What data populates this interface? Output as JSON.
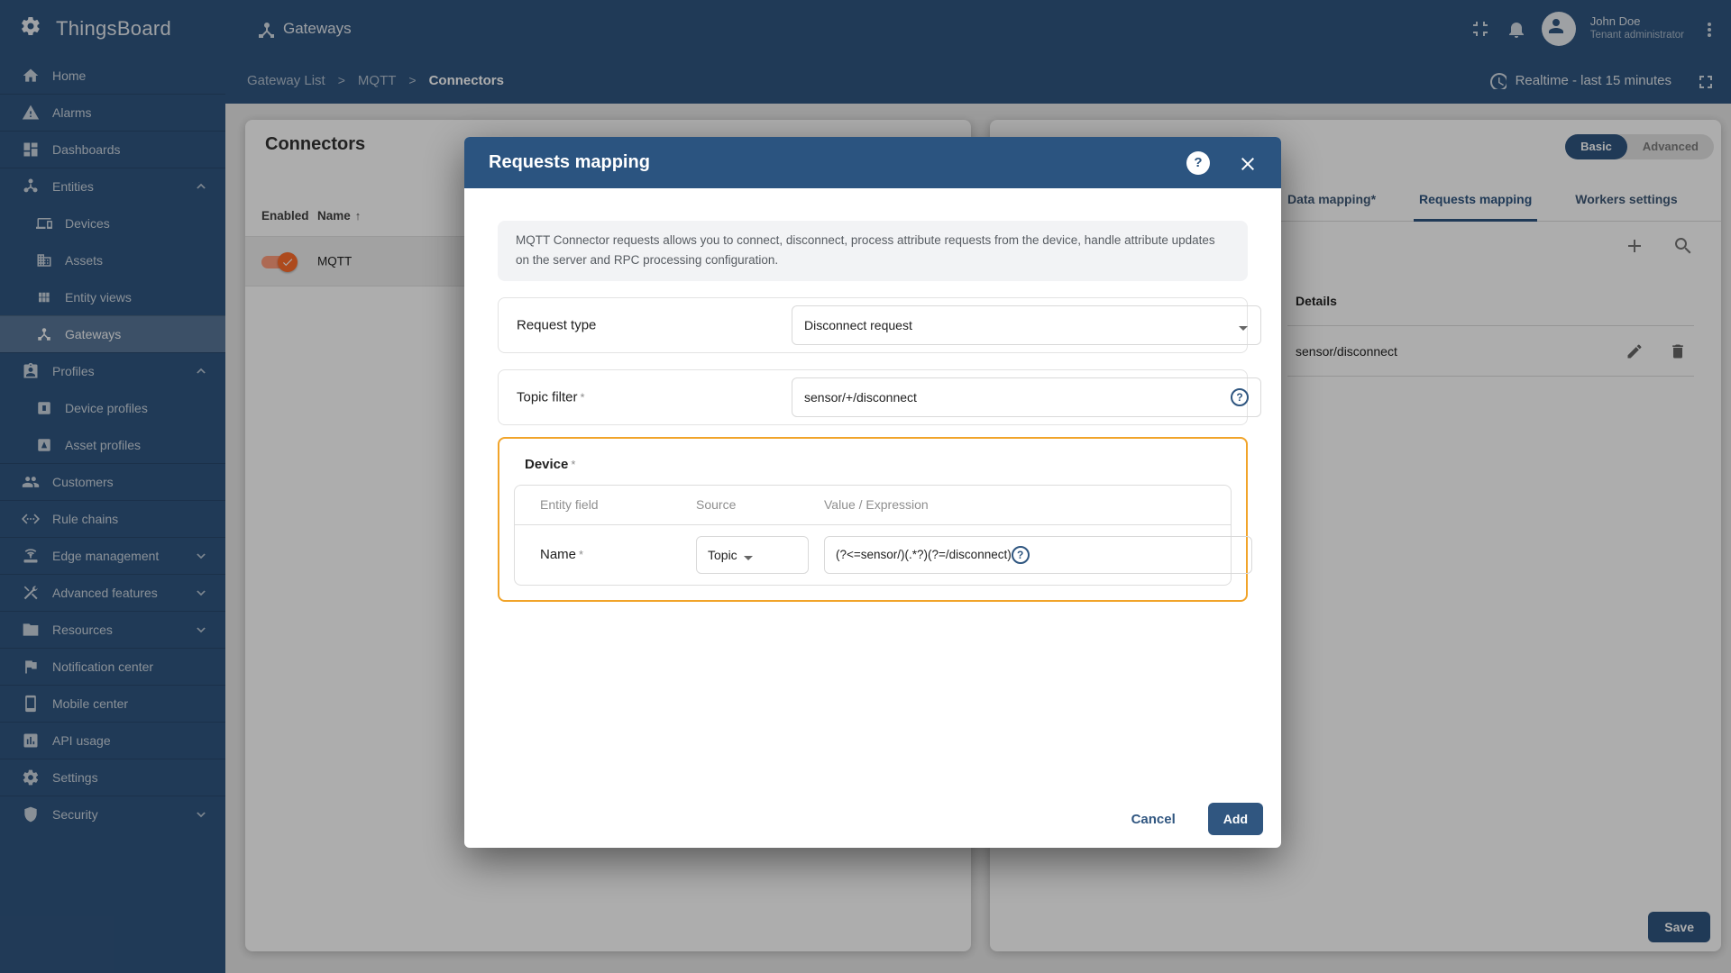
{
  "header": {
    "brand": "ThingsBoard",
    "brand_icon": "thingsboard-logo-icon",
    "page_title": "Gateways",
    "page_title_icon": "device-hub-icon",
    "action_icons": [
      "collapse-icon",
      "notifications-icon"
    ],
    "user": {
      "avatar_icon": "avatar-icon",
      "name": "John Doe",
      "role": "Tenant administrator"
    },
    "menu_icon": "more-vert-icon"
  },
  "toolbar": {
    "time_icon": "clock-icon",
    "time_range": "Realtime - last 15 minutes",
    "fullscreen_icon": "fullscreen-icon"
  },
  "breadcrumb": {
    "separator": ">",
    "items": [
      {
        "label": "Gateway List",
        "active": false
      },
      {
        "label": "MQTT",
        "active": false
      },
      {
        "label": "Connectors",
        "active": true
      }
    ]
  },
  "sidebar": {
    "items": [
      {
        "label": "Home",
        "icon": "home-icon"
      },
      {
        "label": "Alarms",
        "icon": "alarms-icon",
        "divider": true
      },
      {
        "label": "Dashboards",
        "icon": "dashboards-icon",
        "divider": true
      },
      {
        "label": "Entities",
        "icon": "entities-icon",
        "divider": true,
        "chevron": "up"
      },
      {
        "label": "Devices",
        "icon": "devices-icon",
        "sub": true
      },
      {
        "label": "Assets",
        "icon": "assets-icon",
        "sub": true
      },
      {
        "label": "Entity views",
        "icon": "entity-views-icon",
        "sub": true
      },
      {
        "label": "Gateways",
        "icon": "gateways-icon",
        "sub": true,
        "active": true,
        "divider": true
      },
      {
        "label": "Profiles",
        "icon": "profiles-icon",
        "divider": true,
        "chevron": "up"
      },
      {
        "label": "Device profiles",
        "icon": "device-profiles-icon",
        "sub": true
      },
      {
        "label": "Asset profiles",
        "icon": "asset-profiles-icon",
        "sub": true
      },
      {
        "label": "Customers",
        "icon": "customers-icon",
        "divider": true
      },
      {
        "label": "Rule chains",
        "icon": "rule-chains-icon",
        "divider": true
      },
      {
        "label": "Edge management",
        "icon": "edge-management-icon",
        "divider": true,
        "chevron": "down"
      },
      {
        "label": "Advanced features",
        "icon": "advanced-features-icon",
        "divider": true,
        "chevron": "down"
      },
      {
        "label": "Resources",
        "icon": "resources-icon",
        "divider": true,
        "chevron": "down"
      },
      {
        "label": "Notification center",
        "icon": "notification-center-icon",
        "divider": true
      },
      {
        "label": "Mobile center",
        "icon": "mobile-center-icon",
        "divider": true
      },
      {
        "label": "API usage",
        "icon": "api-usage-icon",
        "divider": true
      },
      {
        "label": "Settings",
        "icon": "settings-icon",
        "divider": true
      },
      {
        "label": "Security",
        "icon": "security-icon",
        "divider": true,
        "chevron": "down"
      }
    ]
  },
  "connectors_panel": {
    "title": "Connectors",
    "columns": [
      "Enabled",
      "Name"
    ],
    "sort_glyph": "↑",
    "enabled_icon": "check-icon",
    "rows": [
      {
        "name": "MQTT",
        "enabled": true
      }
    ]
  },
  "connector_panel": {
    "mode_toggle": {
      "options": [
        "Basic",
        "Advanced"
      ],
      "selected": "Basic"
    },
    "tabs": [
      {
        "label": "Data mapping*",
        "active": false
      },
      {
        "label": "Requests mapping",
        "active": true
      },
      {
        "label": "Workers settings",
        "active": false
      }
    ],
    "add_icon": "add-icon",
    "search_icon": "search-icon",
    "details_header": "Details",
    "rows": [
      {
        "topic": "sensor/disconnect",
        "edit_icon": "edit-icon",
        "delete_icon": "delete-icon"
      }
    ],
    "save_label": "Save"
  },
  "modal": {
    "title": "Requests mapping",
    "help_icon": "help-icon",
    "close_icon": "close-icon",
    "info": "MQTT Connector requests allows you to connect, disconnect, process attribute requests from the device, handle attribute updates on the server and RPC processing configuration.",
    "request_type": {
      "label": "Request type",
      "value": "Disconnect request",
      "dropdown_icon": "dropdown-arrow-icon"
    },
    "topic_filter": {
      "label": "Topic filter",
      "required_mark": "*",
      "value": "sensor/+/disconnect",
      "help_icon": "help-outline-icon"
    },
    "device_section": {
      "title": "Device",
      "required_mark": "*",
      "columns": [
        "Entity field",
        "Source",
        "Value / Expression"
      ],
      "row": {
        "entity_field": "Name",
        "required_mark": "*",
        "source": "Topic",
        "dropdown_icon": "dropdown-arrow-icon",
        "expression": "(?<=sensor/)(.*?)(?=/disconnect)",
        "help_icon": "help-outline-icon"
      }
    },
    "cancel_label": "Cancel",
    "add_label": "Add"
  },
  "colors": {
    "primary": "#305680",
    "modal_header": "#2b5480",
    "highlight_border": "#f1a42a",
    "toggle_track": "#ff9d7d",
    "toggle_thumb": "#ff6d2b"
  }
}
